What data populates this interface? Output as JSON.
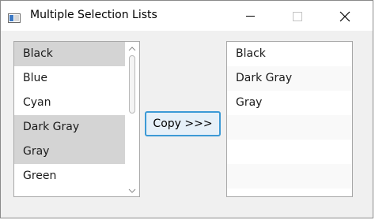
{
  "window": {
    "title": "Multiple Selection Lists",
    "controls": [
      "minimize-icon",
      "maximize-icon",
      "close-icon"
    ]
  },
  "left_list": {
    "items": [
      {
        "label": "Black",
        "selected": true
      },
      {
        "label": "Blue",
        "selected": false
      },
      {
        "label": "Cyan",
        "selected": false
      },
      {
        "label": "Dark Gray",
        "selected": true
      },
      {
        "label": "Gray",
        "selected": true
      },
      {
        "label": "Green",
        "selected": false
      }
    ]
  },
  "copy_button": {
    "label": "Copy >>>"
  },
  "right_list": {
    "items": [
      "Black",
      "Dark Gray",
      "Gray"
    ]
  },
  "colors": {
    "selection": "#d4d4d4",
    "button_border": "#3c9ad6",
    "button_fill": "#e6f0f8"
  }
}
